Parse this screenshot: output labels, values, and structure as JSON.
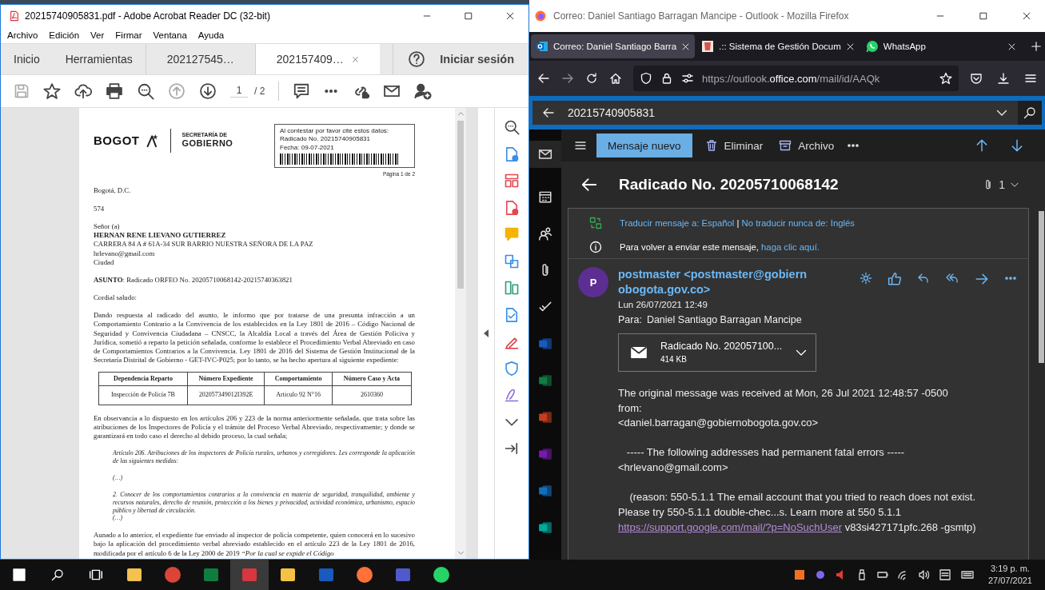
{
  "acrobat": {
    "title": "20215740905831.pdf - Adobe Acrobat Reader DC (32-bit)",
    "menu": [
      "Archivo",
      "Edición",
      "Ver",
      "Firmar",
      "Ventana",
      "Ayuda"
    ],
    "tabs": [
      {
        "label": "Inicio",
        "kind": "nav",
        "selected": false
      },
      {
        "label": "Herramientas",
        "kind": "nav",
        "selected": false
      },
      {
        "label": "202127545…",
        "kind": "doc",
        "selected": false
      },
      {
        "label": "202157409…",
        "kind": "doc",
        "selected": true
      }
    ],
    "sign_in": "Iniciar sesión",
    "page_current": "1",
    "page_total": "/ 2",
    "document": {
      "logo": "BOGOT",
      "dept_small": "SECRETARÍA DE",
      "dept": "GOBIERNO",
      "stamp": [
        "Al contestar por favor cite estos datos:",
        "Radicado No. 20215740905831",
        "Fecha: 09-07-2021"
      ],
      "page_label": "Página 1 de 2",
      "blocks": [
        {
          "kind": "para",
          "text": "Bogotá, D.C."
        },
        {
          "kind": "para",
          "text": "574"
        },
        {
          "kind": "para",
          "text": "Señor (a)"
        },
        {
          "kind": "strong-line",
          "text": "HERNAN RENE LIEVANO GUTIERREZ"
        },
        {
          "kind": "line",
          "text": "CARRERA 84 A # 61A-34 SUR BARRIO NUESTRA SEÑORA DE LA PAZ"
        },
        {
          "kind": "line",
          "text": "hrlevano@gmail.com"
        },
        {
          "kind": "line",
          "text": "Ciudad"
        },
        {
          "kind": "para",
          "text": "**ASUNTO**: Radicado ORFEO No. 20205710068142-20215740363821"
        },
        {
          "kind": "para",
          "text": "Cordial saludo:"
        },
        {
          "kind": "para",
          "text": "Dando respuesta al radicado del asunto, le informo que por tratarse de una presunta infracción a un Comportamiento Contrario a la Convivencia de los establecidos en la Ley 1801 de 2016 – Código Nacional de Seguridad y Convivencia Ciudadana – CNSCC, la Alcaldía Local a través del Área de Gestión Policiva y Jurídica, sometió a reparto la petición señalada, conforme lo establece el Procedimiento Verbal Abreviado en caso de Comportamientos Contrarios a la Convivencia. Ley 1801 de 2016 del Sistema de Gestión Institucional de la Secretaría Distrital de Gobierno - GET-IVC-P025; por lo tanto, se ha hecho apertura al siguiente expediente:"
        },
        {
          "kind": "table",
          "columns": [
            "Dependencia Reparto",
            "Número Expediente",
            "Comportamiento",
            "Número Caso y Acta"
          ],
          "rows": [
            [
              "Inspección de Policía 7B",
              "202057349012I392E",
              "Articulo 92 N°16",
              "2610360"
            ]
          ]
        },
        {
          "kind": "para",
          "text": "En observancia a lo dispuesto en los artículos 206 y 223 de la norma anteriormente señalada, que trata sobre las atribuciones de los Inspectores de Policía y el trámite del Proceso Verbal Abreviado, respectivamente; y donde se garantizará en todo caso el derecho al debido proceso, la cual señala;"
        },
        {
          "kind": "quote",
          "text": "Artículo 206. Atribuciones de los inspectores de Policía rurales, urbanos y corregidores. Les corresponde la aplicación de las siguientes medidas:"
        },
        {
          "kind": "quote",
          "text": "(…)"
        },
        {
          "kind": "quote",
          "text": "2. Conocer de los comportamientos contrarios a la convivencia en materia de seguridad, tranquilidad, ambiente y recursos naturales, derecho de reunión, protección a los bienes y privacidad, actividad económica, urbanismo, espacio público y libertad de circulación."
        },
        {
          "kind": "quote-line",
          "text": "(…)"
        },
        {
          "kind": "para",
          "text": "Aunado a lo anterior, el expediente fue enviado al inspector de policía competente, quien conocerá en lo sucesivo bajo la aplicación del procedimiento verbal abreviado establecido en el artículo 223 de la Ley 1801 de 2016, modificada por el artículo 6 de la Ley 2000 de 2019 *“Por la cual se expide el Código*"
        }
      ]
    }
  },
  "firefox": {
    "title": "Correo: Daniel Santiago Barragan Mancipe - Outlook - Mozilla Firefox",
    "tabs": [
      {
        "label": "Correo: Daniel Santiago Barra",
        "kind": "outlook",
        "selected": true
      },
      {
        "label": ".:: Sistema de Gestión Docum",
        "kind": "documents",
        "selected": false
      },
      {
        "label": "WhatsApp",
        "kind": "whatsapp",
        "selected": false
      }
    ],
    "url": "https://outlook.**office.com**/mail/id/AAQk"
  },
  "outlook": {
    "search": "20215740905831",
    "new_message": "Mensaje nuevo",
    "delete": "Eliminar",
    "archive": "Archivo",
    "rail": [
      {
        "kind": "mail",
        "selected": true
      },
      {
        "kind": "calendar",
        "selected": false
      },
      {
        "kind": "people",
        "selected": false
      },
      {
        "kind": "files",
        "selected": false
      },
      {
        "kind": "todo",
        "selected": false
      },
      {
        "kind": "word",
        "selected": false
      },
      {
        "kind": "excel",
        "selected": false
      },
      {
        "kind": "powerpoint",
        "selected": false
      },
      {
        "kind": "onenote",
        "selected": false
      },
      {
        "kind": "yammer",
        "selected": false
      },
      {
        "kind": "bookings",
        "selected": false
      }
    ],
    "subject": "Radicado No. 20205710068142",
    "attachment_count": "1",
    "translate": "Traducir mensaje a: Español",
    "separator": "|",
    "no_translate": "No traducir nunca de: Inglés",
    "resend": "Para volver a enviar este mensaje,",
    "resend_link": "haga clic aquí.",
    "avatar": "P",
    "sender": "postmaster <postmaster@gobiernobogota.gov.co>",
    "date": "Lun 26/07/2021 12:49",
    "to_label": "Para:",
    "to": "Daniel Santiago Barragan Mancipe",
    "attachment": {
      "name": "Radicado No. 202057100...",
      "size": "414 KB"
    },
    "body": [
      "The original message was received at Mon, 26 Jul 2021 12:48:57 -0500\nfrom:\n<daniel.barragan@gobiernobogota.gov.co>",
      "   ----- The following addresses had permanent fatal errors -----\n<hrlevano@gmail.com>"
    ],
    "reason": {
      "before": "    (reason: 550-5.1.1 The email account that you tried to reach does not exist. Please try 550-5.1.1 double-chec...s. Learn more at 550 5.1.1 ",
      "link": "https://support.google.com/mail/?p=NoSuchUser",
      "after": " v83si427171pfc.268 -gsmtp)"
    }
  },
  "taskbar": {
    "apps": [
      {
        "kind": "files",
        "selected": false
      },
      {
        "kind": "chrome",
        "selected": false
      },
      {
        "kind": "excel",
        "selected": false
      },
      {
        "kind": "acrobat",
        "selected": true
      },
      {
        "kind": "explorer",
        "selected": false
      },
      {
        "kind": "word",
        "selected": false
      },
      {
        "kind": "firefox",
        "selected": false
      },
      {
        "kind": "teams",
        "selected": false
      },
      {
        "kind": "whatsapp",
        "selected": false
      }
    ],
    "time": "3:19 p. m.",
    "date": "27/07/2021"
  }
}
